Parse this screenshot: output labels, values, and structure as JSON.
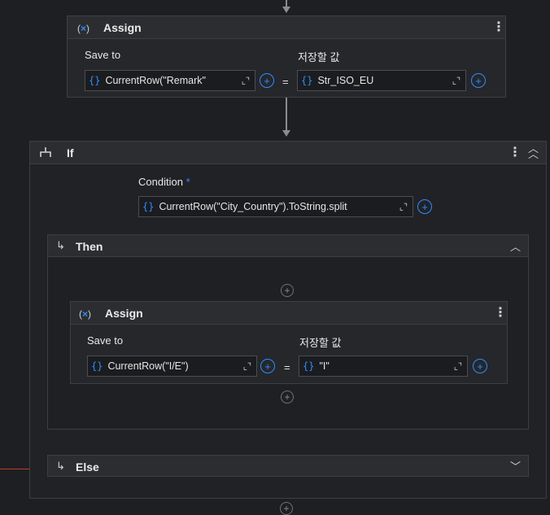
{
  "assign_top": {
    "title": "Assign",
    "save_to_label": "Save to",
    "value_label": "저장할 값",
    "save_to_value": "CurrentRow(\"Remark\"",
    "value_value": "Str_ISO_EU",
    "equals": "="
  },
  "if_block": {
    "title": "If",
    "condition_label": "Condition",
    "required_mark": "*",
    "condition_value": "CurrentRow(\"City_Country\").ToString.split"
  },
  "then_block": {
    "title": "Then"
  },
  "assign_inner": {
    "title": "Assign",
    "save_to_label": "Save to",
    "value_label": "저장할 값",
    "save_to_value": "CurrentRow(\"I/E\")",
    "value_value": "\"I\"",
    "equals": "="
  },
  "else_block": {
    "title": "Else"
  },
  "icons": {
    "variable": "variable-x-icon",
    "brace": "expression-brace-icon",
    "expand": "expand-editor-icon",
    "add": "add-circle-icon",
    "kebab": "more-options-icon",
    "branch": "if-branch-icon",
    "collapse_all": "collapse-double-chevron-icon",
    "chevron_up": "chevron-up-icon",
    "chevron_down": "chevron-down-icon",
    "branch_arrow": "branch-arrow-icon"
  },
  "colors": {
    "accent": "#2f8cff",
    "required": "#2f8cff",
    "background": "#1e1f22",
    "panel": "#25272b",
    "border": "#3c3f44",
    "connector_red": "#c0392b"
  }
}
